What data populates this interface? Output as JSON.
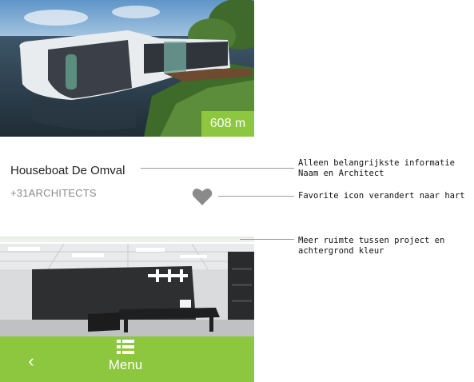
{
  "card1": {
    "distance": "608 m",
    "title": "Houseboat De Omval",
    "architect": "+31ARCHITECTS"
  },
  "bottom_bar": {
    "back_glyph": "‹",
    "menu_label": "Menu",
    "menu_icon": "list-icon"
  },
  "annotations": [
    "Alleen belangrijkste informatie",
    "Naam en Architect",
    "Favorite icon verandert naar hart",
    "Meer ruimte tussen project en",
    "achtergrond kleur"
  ],
  "colors": {
    "accent": "#8dc63f",
    "heart": "#8a8a8a"
  }
}
